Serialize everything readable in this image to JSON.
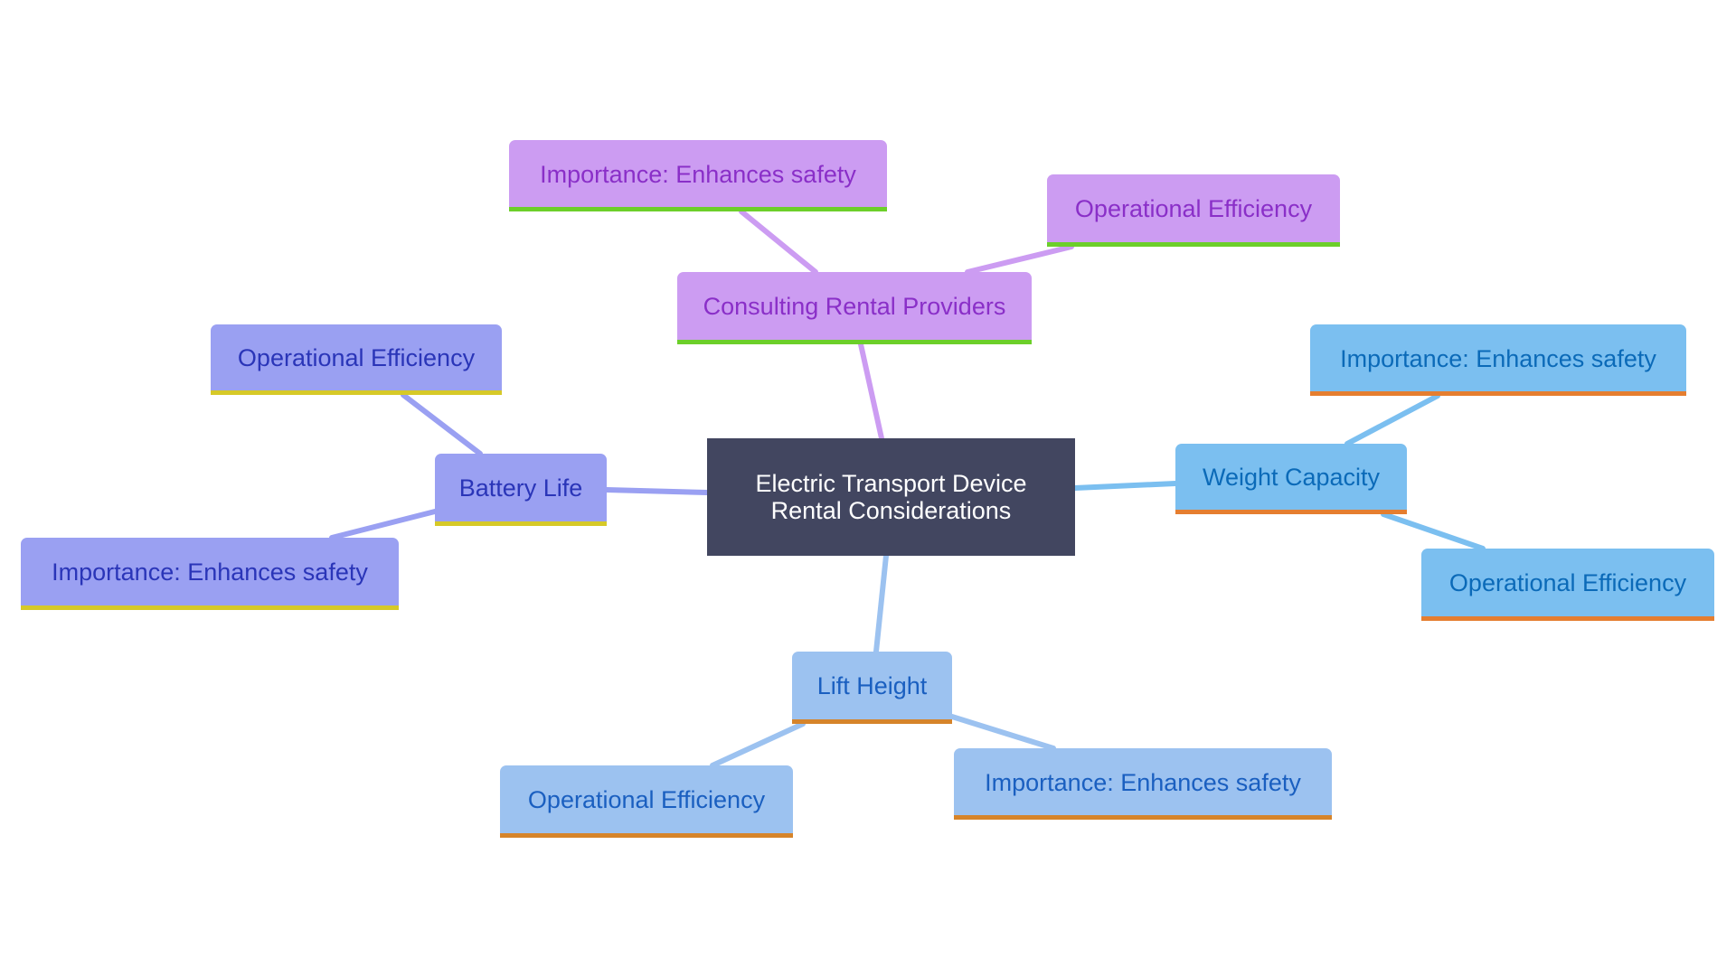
{
  "diagram": {
    "type": "mindmap",
    "root": {
      "label": "Electric Transport Device\nRental Considerations",
      "fill": "#424660",
      "text_color": "#ffffff"
    },
    "branches": [
      {
        "id": "consulting",
        "label": "Consulting Rental Providers",
        "fill": "#cc9cf2",
        "text_color": "#8a2fc8",
        "underline": "#6ccf2a",
        "edge_color": "#cc9cf2",
        "children": [
          {
            "id": "consulting-importance",
            "label": "Importance: Enhances safety"
          },
          {
            "id": "consulting-efficiency",
            "label": "Operational Efficiency"
          }
        ]
      },
      {
        "id": "battery",
        "label": "Battery Life",
        "fill": "#9aa0f2",
        "text_color": "#2a35b8",
        "underline": "#d6c928",
        "edge_color": "#9aa0f2",
        "children": [
          {
            "id": "battery-efficiency",
            "label": "Operational Efficiency"
          },
          {
            "id": "battery-importance",
            "label": "Importance: Enhances safety"
          }
        ]
      },
      {
        "id": "weight",
        "label": "Weight Capacity",
        "fill": "#7bbff0",
        "text_color": "#0b6ab8",
        "underline": "#e57e30",
        "edge_color": "#7bbff0",
        "children": [
          {
            "id": "weight-importance",
            "label": "Importance: Enhances safety"
          },
          {
            "id": "weight-efficiency",
            "label": "Operational Efficiency"
          }
        ]
      },
      {
        "id": "lift",
        "label": "Lift Height",
        "fill": "#9cc2f0",
        "text_color": "#1a5fc0",
        "underline": "#d6842a",
        "edge_color": "#9cc2f0",
        "children": [
          {
            "id": "lift-efficiency",
            "label": "Operational Efficiency"
          },
          {
            "id": "lift-importance",
            "label": "Importance: Enhances safety"
          }
        ]
      }
    ]
  }
}
